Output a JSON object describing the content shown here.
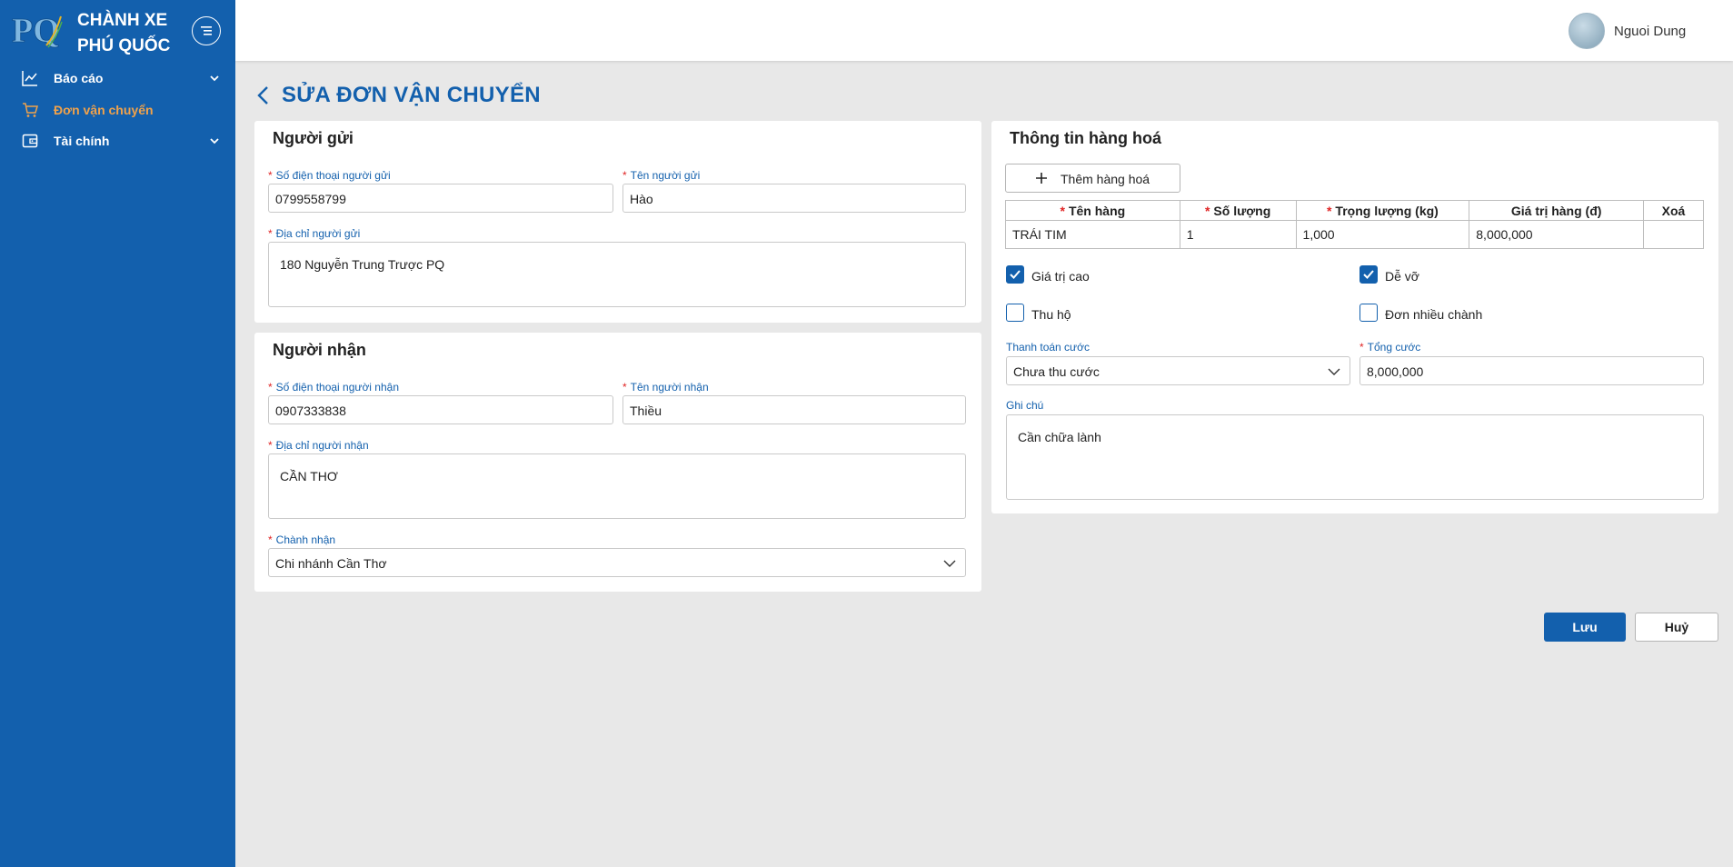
{
  "brand": {
    "logo_text": "PQ",
    "line1": "CHÀNH XE",
    "line2": "PHÚ QUỐC"
  },
  "sidebar": {
    "items": [
      {
        "label": "Báo cáo",
        "icon": "line-chart-icon",
        "expandable": true,
        "active": false
      },
      {
        "label": "Đơn vận chuyển",
        "icon": "cart-icon",
        "expandable": false,
        "active": true
      },
      {
        "label": "Tài chính",
        "icon": "wallet-icon",
        "expandable": true,
        "active": false
      }
    ]
  },
  "header": {
    "username": "Nguoi Dung"
  },
  "page": {
    "title": "SỬA ĐƠN VẬN CHUYỂN"
  },
  "sender": {
    "title": "Người gửi",
    "phone_label": "Số điện thoại người gửi",
    "phone_value": "0799558799",
    "name_label": "Tên người gửi",
    "name_value": "Hào",
    "address_label": "Địa chỉ người gửi",
    "address_value": "180 Nguyễn Trung Trược PQ"
  },
  "receiver": {
    "title": "Người nhận",
    "phone_label": "Số điện thoại người nhận",
    "phone_value": "0907333838",
    "name_label": "Tên người nhận",
    "name_value": "Thiều",
    "address_label": "Địa chỉ người nhận",
    "address_value": "CẦN THƠ",
    "branch_label": "Chành nhận",
    "branch_value": "Chi nhánh Cần Thơ"
  },
  "goods": {
    "title": "Thông tin hàng hoá",
    "add_button": "Thêm hàng hoá",
    "columns": [
      "Tên hàng",
      "Số lượng",
      "Trọng lượng (kg)",
      "Giá trị hàng (đ)",
      "Xoá"
    ],
    "rows": [
      {
        "name": "TRÁI TIM",
        "qty": "1",
        "weight": "1,000",
        "value": "8,000,000"
      }
    ],
    "checkboxes": [
      {
        "label": "Giá trị cao",
        "checked": true
      },
      {
        "label": "Dễ vỡ",
        "checked": true
      },
      {
        "label": "Thu hộ",
        "checked": false
      },
      {
        "label": "Đơn nhiều chành",
        "checked": false
      }
    ],
    "payment_label": "Thanh toán cước",
    "payment_value": "Chưa thu cước",
    "total_label": "Tổng cước",
    "total_value": "8,000,000",
    "note_label": "Ghi chú",
    "note_value": "Cần chữa lành"
  },
  "actions": {
    "save": "Lưu",
    "cancel": "Huỷ"
  },
  "colors": {
    "primary": "#1360ad",
    "active_nav": "#f0a24b",
    "required": "#e02424",
    "background": "#e8e8e8"
  }
}
